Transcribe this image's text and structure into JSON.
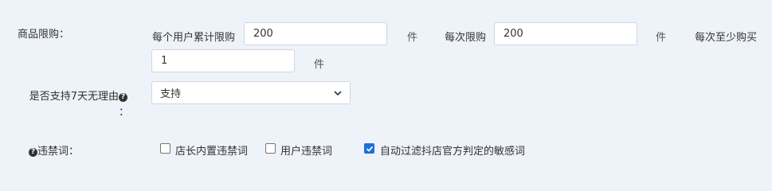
{
  "purchase_limit": {
    "label": "商品限购：",
    "per_user_label": "每个用户累计限购",
    "per_user_value": "200",
    "unit1": "件",
    "per_order_label": "每次限购",
    "per_order_value": "200",
    "unit2": "件",
    "min_label": "每次至少购买",
    "min_value": "1",
    "unit3": "件"
  },
  "return_policy": {
    "label": "是否支持7天无理由",
    "colon": "：",
    "help_icon": "question-circle-icon",
    "selected": "支持"
  },
  "banned_words": {
    "help_icon": "question-circle-icon",
    "label": "违禁词：",
    "options": [
      {
        "label": "店长内置违禁词",
        "checked": false
      },
      {
        "label": "用户违禁词",
        "checked": false
      },
      {
        "label": "自动过滤抖店官方判定的敏感词",
        "checked": true
      }
    ]
  },
  "colors": {
    "accent": "#1e6fd9",
    "background": "#eef2f9"
  }
}
